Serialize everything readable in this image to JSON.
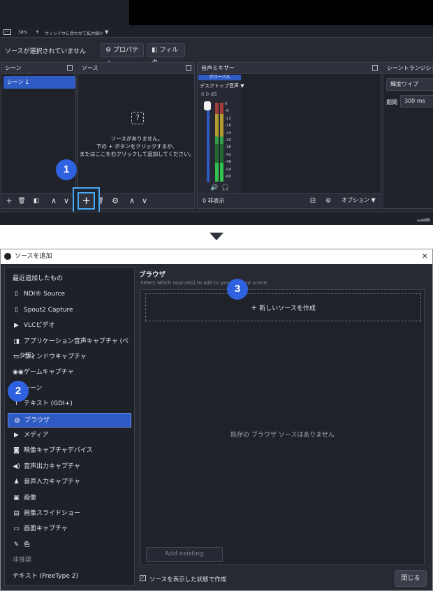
{
  "top": {
    "zoom_label": "38%",
    "zoom_plus": "+",
    "zoom_mode": "ウィンドウに合わせて拡大縮小",
    "no_source": "ソースが選択されていません",
    "properties": "プロパティ",
    "filters": "フィルタ",
    "scenes_dock": {
      "title": "シーン",
      "items": [
        "シーン 1"
      ]
    },
    "sources_dock": {
      "title": "ソース",
      "empty_line1": "ソースがありません。",
      "empty_line2": "下の + ボタンをクリックするか、",
      "empty_line3": "またはここを右クリックして追加してください。"
    },
    "mixer_dock": {
      "title": "音声ミキサー",
      "global_label": "グローバル",
      "device": "デスクトップ音声",
      "db": "0.0 dB",
      "scale": [
        "0",
        "-6",
        "-12",
        "-18",
        "-24",
        "-30",
        "-36",
        "-42",
        "-48",
        "-54",
        "-60"
      ],
      "hidden": "0 非表示",
      "options": "オプション"
    },
    "transitions_dock": {
      "title": "シーントランジション",
      "type": "輝度ワイプ",
      "duration_label": "期間",
      "duration": "300 ms"
    },
    "add_plus": "+",
    "badge1": "1"
  },
  "dialog": {
    "title": "ソースを追加",
    "close_x": "✕",
    "badge2": "2",
    "badge3": "3",
    "section_title": "ブラウザ",
    "subtitle": "Select which source(s) to add to your current scene.",
    "new_source": "新しいソースを作成",
    "empty_msg": "既存の ブラウザ ソースはありません",
    "add_existing": "Add existing",
    "checkbox_label": "ソースを表示した状態で作成",
    "close_button": "閉じる",
    "list": [
      {
        "label": "最近追加したもの",
        "icon": ""
      },
      {
        "label": "NDI® Source",
        "icon": "file-icon"
      },
      {
        "label": "Spout2 Capture",
        "icon": "file-icon"
      },
      {
        "label": "VLCビデオ",
        "icon": "play-icon"
      },
      {
        "label": "アプリケーション音声キャプチャ (ベータ版)",
        "icon": "app-audio-icon"
      },
      {
        "label": "ウィンドウキャプチャ",
        "icon": "window-icon"
      },
      {
        "label": "ゲームキャプチャ",
        "icon": "gamepad-icon"
      },
      {
        "label": "シーン",
        "icon": "scene-icon"
      },
      {
        "label": "テキスト (GDI+)",
        "icon": "text-icon"
      },
      {
        "label": "ブラウザ",
        "icon": "globe-icon"
      },
      {
        "label": "メディア",
        "icon": "play-icon"
      },
      {
        "label": "映像キャプチャデバイス",
        "icon": "camera-icon"
      },
      {
        "label": "音声出力キャプチャ",
        "icon": "speaker-icon"
      },
      {
        "label": "音声入力キャプチャ",
        "icon": "mic-icon"
      },
      {
        "label": "画像",
        "icon": "image-icon"
      },
      {
        "label": "画像スライドショー",
        "icon": "slideshow-icon"
      },
      {
        "label": "画面キャプチャ",
        "icon": "monitor-icon"
      },
      {
        "label": "色",
        "icon": "brush-icon"
      },
      {
        "label": "非推奨",
        "icon": ""
      },
      {
        "label": "テキスト (FreeType 2)",
        "icon": ""
      }
    ]
  },
  "colors": {
    "accent": "#2f62e0",
    "highlight": "#4aa8f0",
    "selected": "#2f5bc4",
    "panel": "#272a33"
  }
}
